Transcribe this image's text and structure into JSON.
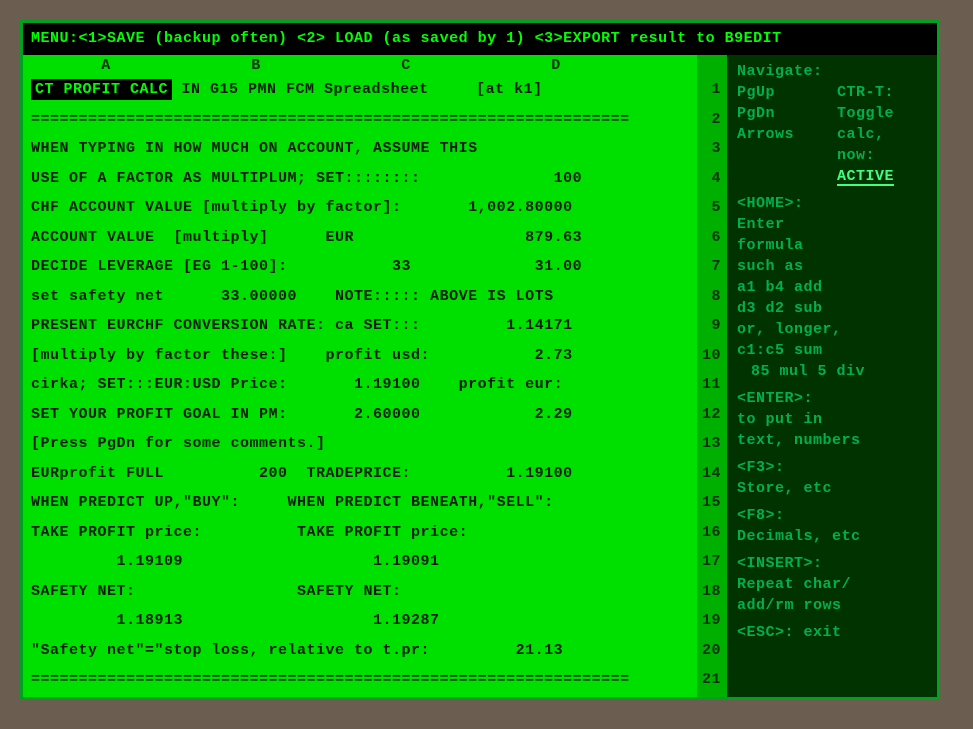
{
  "menu": "MENU:<1>SAVE (backup often) <2> LOAD (as saved by 1) <3>EXPORT result to B9EDIT",
  "columns": [
    "A",
    "B",
    "C",
    "D"
  ],
  "cursor_cell": "CT PROFIT CALC",
  "rows": [
    {
      "n": 1,
      "after_cursor": " IN G15 PMN FCM Spreadsheet     [at k1]"
    },
    {
      "n": 2,
      "text": "===============================================================",
      "ruler": true
    },
    {
      "n": 3,
      "text": "WHEN TYPING IN HOW MUCH ON ACCOUNT, ASSUME THIS"
    },
    {
      "n": 4,
      "text": "USE OF A FACTOR AS MULTIPLUM; SET::::::::              100"
    },
    {
      "n": 5,
      "text": "CHF ACCOUNT VALUE [multiply by factor]:       1,002.80000"
    },
    {
      "n": 6,
      "text": "ACCOUNT VALUE  [multiply]      EUR                  879.63"
    },
    {
      "n": 7,
      "text": "DECIDE LEVERAGE [EG 1-100]:           33             31.00"
    },
    {
      "n": 8,
      "text": "set safety net      33.00000    NOTE::::: ABOVE IS LOTS"
    },
    {
      "n": 9,
      "text": "PRESENT EURCHF CONVERSION RATE: ca SET:::         1.14171"
    },
    {
      "n": 10,
      "text": "[multiply by factor these:]    profit usd:           2.73"
    },
    {
      "n": 11,
      "text": "cirka; SET:::EUR:USD Price:       1.19100    profit eur:"
    },
    {
      "n": 12,
      "text": "SET YOUR PROFIT GOAL IN PM:       2.60000            2.29"
    },
    {
      "n": 13,
      "text": "[Press PgDn for some comments.]"
    },
    {
      "n": 14,
      "text": "EURprofit FULL          200  TRADEPRICE:          1.19100"
    },
    {
      "n": 15,
      "text": "WHEN PREDICT UP,\"BUY\":     WHEN PREDICT BENEATH,\"SELL\":"
    },
    {
      "n": 16,
      "text": "TAKE PROFIT price:          TAKE PROFIT price:"
    },
    {
      "n": 17,
      "text": "         1.19109                    1.19091"
    },
    {
      "n": 18,
      "text": "SAFETY NET:                 SAFETY NET:"
    },
    {
      "n": 19,
      "text": "         1.18913                    1.19287"
    },
    {
      "n": 20,
      "text": "\"Safety net\"=\"stop loss, relative to t.pr:         21.13"
    },
    {
      "n": 21,
      "text": "===============================================================",
      "ruler": true
    }
  ],
  "help": {
    "nav_title": "Navigate:",
    "nav_items": [
      "PgUp",
      "PgDn",
      "Arrows"
    ],
    "ctr_t_label": "CTR-T:",
    "ctr_t_lines": [
      "Toggle",
      "calc,",
      "now:"
    ],
    "active": "ACTIVE",
    "home_label": "<HOME>:",
    "home_lines": [
      "Enter",
      "formula",
      "such as",
      "a1 b4 add",
      "d3 d2 sub",
      "or, longer,",
      "c1:c5 sum"
    ],
    "mul_div": "85 mul 5 div",
    "enter_label": "<ENTER>:",
    "enter_lines": [
      "to put in",
      "text, numbers"
    ],
    "f3_label": "<F3>:",
    "f3_line": "Store, etc",
    "f8_label": "<F8>:",
    "f8_line": "Decimals, etc",
    "insert_label": "<INSERT>:",
    "insert_lines": [
      "Repeat char/",
      "add/rm rows"
    ],
    "esc": "<ESC>: exit"
  }
}
